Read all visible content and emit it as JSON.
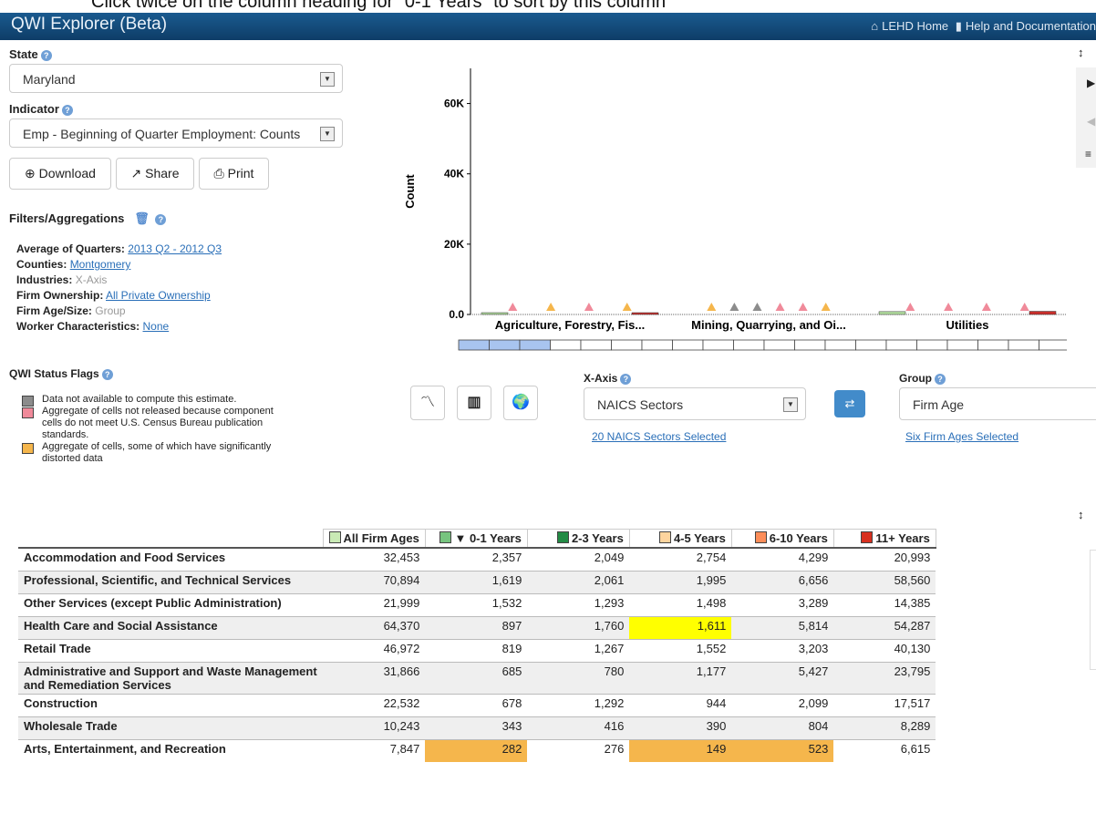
{
  "instruction": "Click twice on the column heading for \"0-1 Years\" to sort by this column",
  "app": {
    "title": "QWI Explorer (Beta)",
    "home_link": "LEHD Home",
    "help_link": "Help and Documentation"
  },
  "state": {
    "label": "State",
    "value": "Maryland"
  },
  "indicator": {
    "label": "Indicator",
    "value": "Emp - Beginning of Quarter Employment: Counts"
  },
  "actions": {
    "download": "Download",
    "share": "Share",
    "print": "Print"
  },
  "filters": {
    "title": "Filters/Aggregations",
    "items": [
      {
        "label": "Average of Quarters:",
        "value": "2013 Q2 - 2012 Q3"
      },
      {
        "label": "Counties:",
        "value": "Montgomery"
      },
      {
        "label": "Industries:",
        "value": "X-Axis"
      },
      {
        "label": "Firm Ownership:",
        "value": "All Private Ownership"
      },
      {
        "label": "Firm Age/Size:",
        "value": "Group"
      },
      {
        "label": "Worker Characteristics:",
        "value": "None"
      }
    ]
  },
  "flags": {
    "title": "QWI Status Flags",
    "items": [
      {
        "text": "Data not available to compute this estimate.",
        "color": "#8c8c8c"
      },
      {
        "text": "Aggregate of cells not released because component cells do not meet U.S. Census Bureau publication standards.",
        "color": "#f08a9a"
      },
      {
        "text": "Aggregate of cells, some of which have significantly distorted data",
        "color": "#f5b64c"
      }
    ]
  },
  "xaxis": {
    "label": "X-Axis",
    "value": "NAICS Sectors",
    "selected_link": "20 NAICS Sectors Selected"
  },
  "group": {
    "label": "Group",
    "value": "Firm Age",
    "selected_link": "Six Firm Ages Selected"
  },
  "chart_data": {
    "type": "bar",
    "ylabel": "Count",
    "ylim": [
      0,
      70000
    ],
    "yticks": [
      "0.0",
      "20K",
      "40K",
      "60K"
    ],
    "ytick_values": [
      0,
      20000,
      40000,
      60000
    ],
    "categories": [
      "Agriculture, Forestry, Fis...",
      "Mining, Quarrying, and Oi...",
      "Utilities"
    ],
    "series": [
      {
        "values": [
          102,
          null,
          810
        ]
      },
      {
        "values": [
          null,
          null,
          null
        ]
      },
      {
        "values": [
          null,
          null,
          null
        ]
      },
      {
        "values": [
          null,
          null,
          null
        ]
      },
      {
        "values": [
          null,
          null,
          null
        ]
      },
      {
        "values": [
          100,
          null,
          900
        ]
      }
    ],
    "flags_per_category": [
      [
        "pink",
        "orange",
        "pink",
        "orange"
      ],
      [
        "orange",
        "grey",
        "grey",
        "pink",
        "pink",
        "orange"
      ],
      [
        "pink",
        "pink",
        "pink",
        "pink"
      ]
    ],
    "colors": {
      "pink": "#f08a9a",
      "orange": "#f5b64c",
      "grey": "#8c8c8c",
      "all": "#b3dea0",
      "d01": "#6fc17a",
      "d23": "#248a4b",
      "d45": "#fcd19a",
      "d610": "#f5915a",
      "d11": "#c9302c"
    }
  },
  "table": {
    "headers": [
      {
        "label": "All Firm Ages",
        "color": "#c9eab5"
      },
      {
        "label": "▼ 0-1 Years",
        "color": "#77c47f"
      },
      {
        "label": "2-3 Years",
        "color": "#238b45"
      },
      {
        "label": "4-5 Years",
        "color": "#fdd49e"
      },
      {
        "label": "6-10 Years",
        "color": "#fc8d59"
      },
      {
        "label": "11+ Years",
        "color": "#d7301f"
      }
    ],
    "rows": [
      {
        "name": "Accommodation and Food Services",
        "values": [
          "32,453",
          "2,357",
          "2,049",
          "2,754",
          "4,299",
          "20,993"
        ]
      },
      {
        "name": "Professional, Scientific, and Technical Services",
        "values": [
          "70,894",
          "1,619",
          "2,061",
          "1,995",
          "6,656",
          "58,560"
        ]
      },
      {
        "name": "Other Services (except Public Administration)",
        "values": [
          "21,999",
          "1,532",
          "1,293",
          "1,498",
          "3,289",
          "14,385"
        ]
      },
      {
        "name": "Health Care and Social Assistance",
        "values": [
          "64,370",
          "897",
          "1,760",
          "1,611",
          "5,814",
          "54,287"
        ]
      },
      {
        "name": "Retail Trade",
        "values": [
          "46,972",
          "819",
          "1,267",
          "1,552",
          "3,203",
          "40,130"
        ]
      },
      {
        "name": "Administrative and Support and Waste Management and Remediation Services",
        "values": [
          "31,866",
          "685",
          "780",
          "1,177",
          "5,427",
          "23,795"
        ]
      },
      {
        "name": "Construction",
        "values": [
          "22,532",
          "678",
          "1,292",
          "944",
          "2,099",
          "17,517"
        ]
      },
      {
        "name": "Wholesale Trade",
        "values": [
          "10,243",
          "343",
          "416",
          "390",
          "804",
          "8,289"
        ]
      },
      {
        "name": "Arts, Entertainment, and Recreation",
        "values": [
          "7,847",
          "282",
          "276",
          "149",
          "523",
          "6,615"
        ]
      }
    ]
  }
}
